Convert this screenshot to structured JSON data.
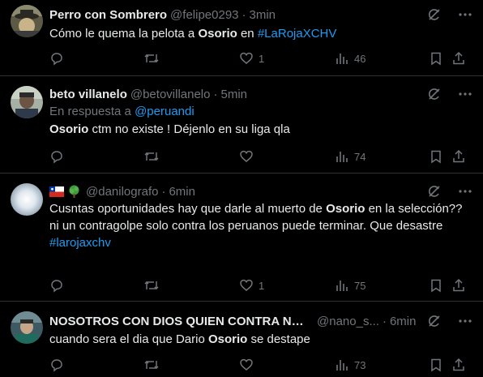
{
  "tweets": [
    {
      "name": "Perro con Sombrero",
      "handle": "@felipe0293",
      "time": "3min",
      "text_before": "Cómo le quema la pelota a ",
      "text_bold": "Osorio",
      "text_after": " en ",
      "hashtag": "#LaRojaXCHV",
      "replies": "",
      "retweets": "",
      "likes": "1",
      "views": "46"
    },
    {
      "name": "beto villanelo",
      "handle": "@betovillanelo",
      "time": "5min",
      "reply_prefix": "En respuesta a ",
      "reply_handle": "@peruandi",
      "text_bold": "Osorio",
      "text_after": " ctm no existe ! Déjenlo en su liga qla",
      "replies": "",
      "retweets": "",
      "likes": "",
      "views": "74"
    },
    {
      "name": "",
      "handle": "@danilografo",
      "time": "6min",
      "text_before": "Cusntas oportunidades hay que darle al muerto de ",
      "text_bold": "Osorio",
      "text_after": " en la selección??  ni un contragolpe solo contra los peruanos puede terminar. Que desastre",
      "hashtag": "#larojaxchv",
      "replies": "",
      "retweets": "",
      "likes": "1",
      "views": "75"
    },
    {
      "name": "NOSOTROS CON DIOS QUIEN CONTRA NOS...",
      "handle": "@nano_s...",
      "time": "6min",
      "text_before": "cuando sera el dia que Dario ",
      "text_bold": "Osorio",
      "text_after": " se destape",
      "replies": "",
      "retweets": "",
      "likes": "",
      "views": "73"
    }
  ],
  "dot": "·",
  "colors": {
    "background": "#000000",
    "text": "#e7e9ea",
    "muted": "#71767b",
    "link": "#1d9bf0",
    "divider": "#2f3336"
  },
  "icons": [
    "grok-icon",
    "more-icon",
    "reply-icon",
    "retweet-icon",
    "like-icon",
    "views-icon",
    "bookmark-icon",
    "share-icon",
    "chile-flag-icon",
    "tree-icon"
  ]
}
